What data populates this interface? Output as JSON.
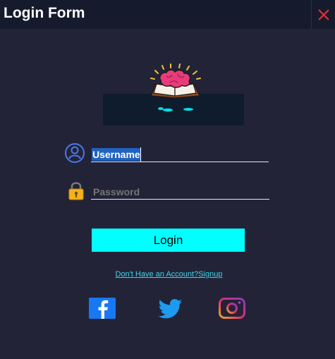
{
  "window": {
    "title": "Login Form",
    "close_label": "X"
  },
  "icons": {
    "logo": "book-brain-icon",
    "user": "user-icon",
    "password": "padlock-icon",
    "facebook": "facebook-icon",
    "twitter": "twitter-icon",
    "instagram": "instagram-icon"
  },
  "form": {
    "username_value": "Username",
    "password_placeholder": "Password",
    "login_label": "Login",
    "signup_link": "Don't Have an Account?Signup"
  },
  "colors": {
    "background": "#232338",
    "titlebar": "#151a2c",
    "accent": "#00ffff",
    "close": "#e03030",
    "link": "#3ad7e6"
  }
}
